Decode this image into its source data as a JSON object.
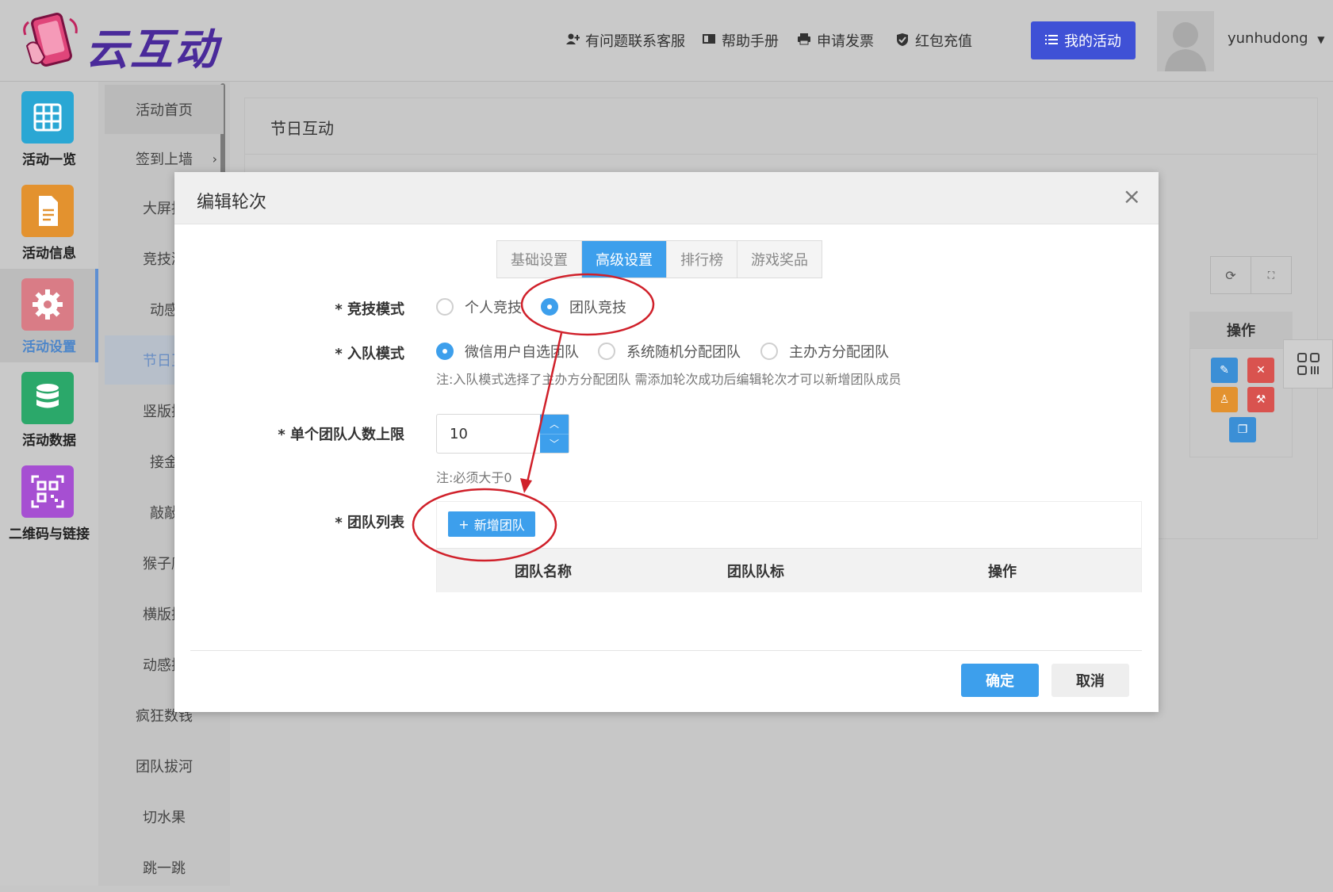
{
  "header": {
    "logo_text": "云互动",
    "nav": [
      {
        "label": "有问题联系客服",
        "icon": "user-plus-icon"
      },
      {
        "label": "帮助手册",
        "icon": "book-icon"
      },
      {
        "label": "申请发票",
        "icon": "printer-icon"
      },
      {
        "label": "红包充值",
        "icon": "shield-check-icon"
      }
    ],
    "my_activity": "我的活动",
    "username": "yunhudong"
  },
  "leftbar": [
    {
      "label": "活动一览",
      "icon": "grid-icon",
      "color": "#2aa7d4"
    },
    {
      "label": "活动信息",
      "icon": "document-icon",
      "color": "#e3922f"
    },
    {
      "label": "活动设置",
      "icon": "gear-icon",
      "color": "#d97c86",
      "active": true
    },
    {
      "label": "活动数据",
      "icon": "database-icon",
      "color": "#2ba86a"
    },
    {
      "label": "二维码与链接",
      "icon": "qrcode-icon",
      "color": "#a64fd2"
    }
  ],
  "subbar": [
    {
      "label": "活动首页"
    },
    {
      "label": "签到上墙",
      "arrow": "›"
    },
    {
      "label": "大屏抽"
    },
    {
      "label": "竞技游"
    },
    {
      "label": "动感"
    },
    {
      "label": "节日互"
    },
    {
      "label": "竖版摇"
    },
    {
      "label": "接金"
    },
    {
      "label": "敲敲"
    },
    {
      "label": "猴子爬"
    },
    {
      "label": "横版摇"
    },
    {
      "label": "动感摇"
    },
    {
      "label": "疯狂数钱"
    },
    {
      "label": "团队拔河"
    },
    {
      "label": "切水果"
    },
    {
      "label": "跳一跳"
    }
  ],
  "page": {
    "title": "节日互动",
    "op_header": "操作"
  },
  "modal": {
    "title": "编辑轮次",
    "close": "×",
    "tabs": [
      "基础设置",
      "高级设置",
      "排行榜",
      "游戏奖品"
    ],
    "active_tab": "高级设置",
    "fields": {
      "mode_label": "* 竞技模式",
      "mode_options": [
        "个人竞技",
        "团队竞技"
      ],
      "mode_selected": "团队竞技",
      "join_label": "* 入队模式",
      "join_options": [
        "微信用户自选团队",
        "系统随机分配团队",
        "主办方分配团队"
      ],
      "join_selected": "微信用户自选团队",
      "join_note": "注:入队模式选择了主办方分配团队 需添加轮次成功后编辑轮次才可以新增团队成员",
      "limit_label": "* 单个团队人数上限",
      "limit_value": "10",
      "limit_note": "注:必须大于0",
      "team_label": "* 团队列表",
      "add_team": "新增团队",
      "add_icon": "+",
      "columns": [
        "团队名称",
        "团队队标",
        "操作"
      ]
    },
    "confirm": "确定",
    "cancel": "取消"
  },
  "colors": {
    "primary": "#3d9fec",
    "nav_button": "#3f51d6",
    "annotation": "#d0202a"
  }
}
